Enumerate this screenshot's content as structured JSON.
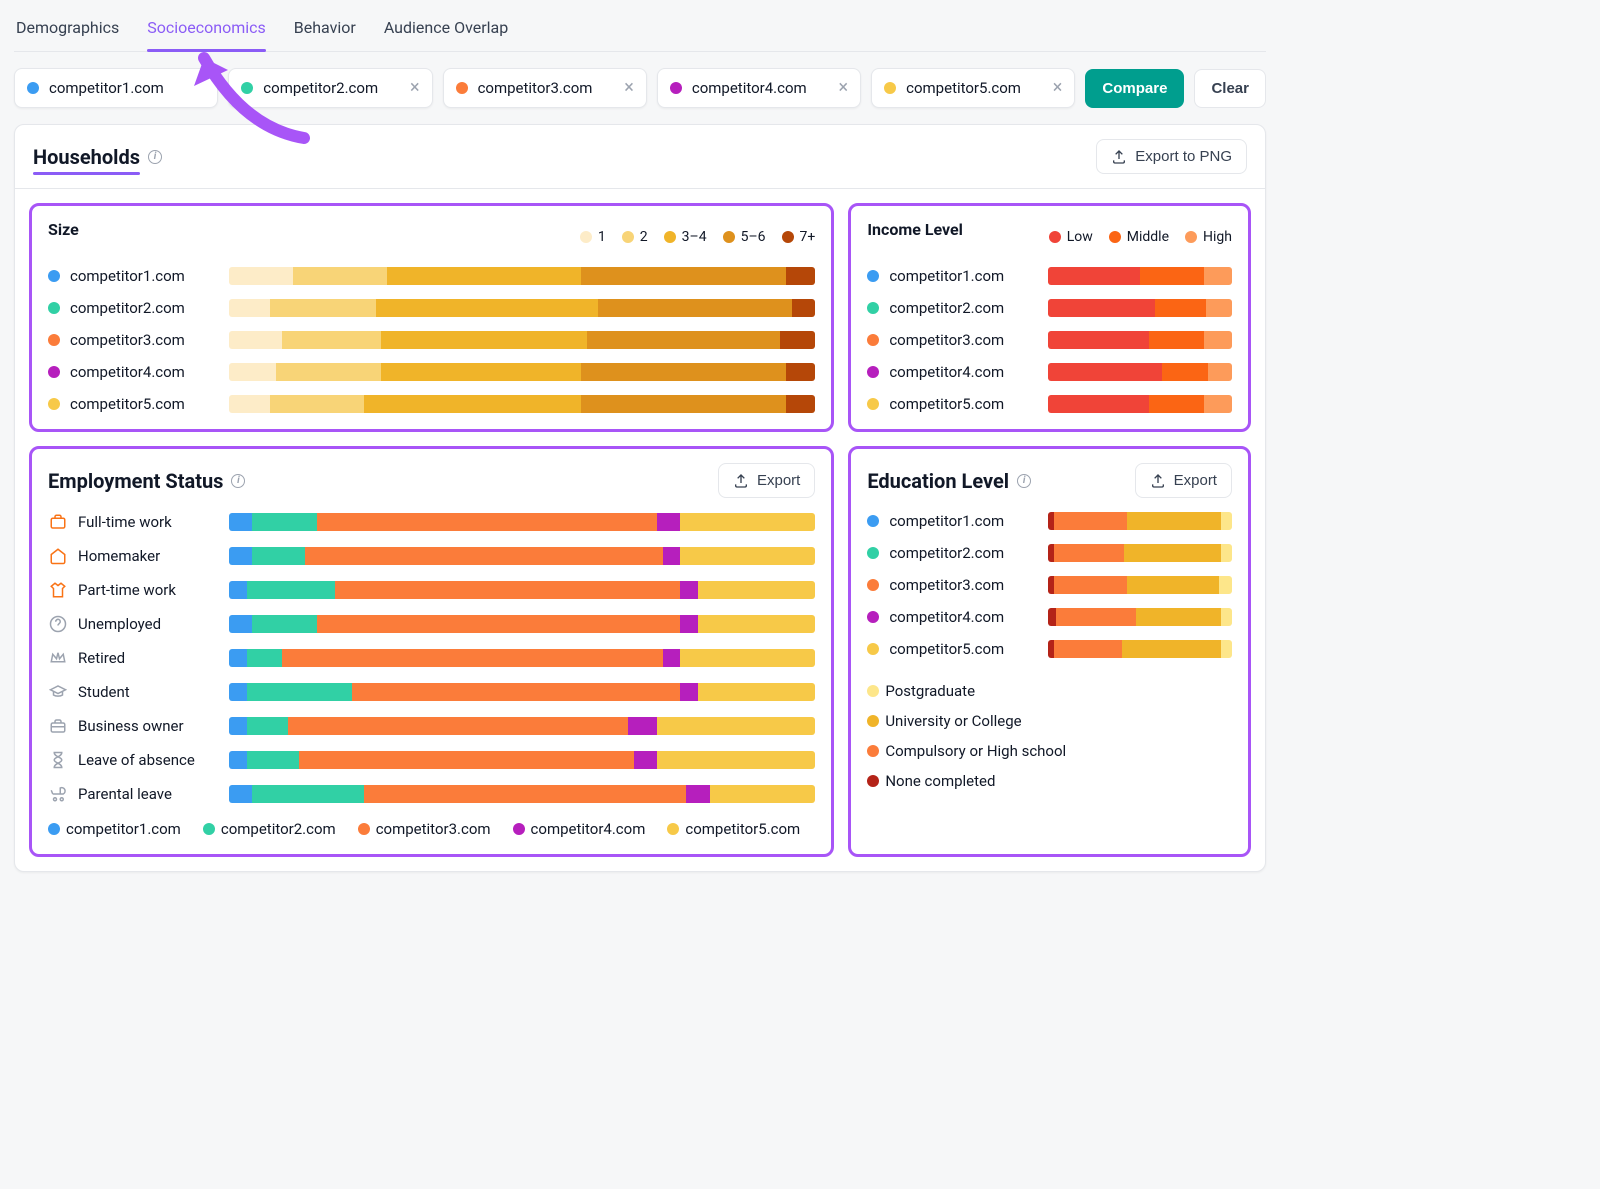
{
  "tabs": [
    "Demographics",
    "Socioeconomics",
    "Behavior",
    "Audience Overlap"
  ],
  "active_tab": 1,
  "competitors": [
    {
      "name": "competitor1.com",
      "color": "#3b9cf2",
      "removable": false
    },
    {
      "name": "competitor2.com",
      "color": "#31d0a5",
      "removable": true
    },
    {
      "name": "competitor3.com",
      "color": "#fb7c3a",
      "removable": true
    },
    {
      "name": "competitor4.com",
      "color": "#b61fbd",
      "removable": true
    },
    {
      "name": "competitor5.com",
      "color": "#f7c948",
      "removable": true
    }
  ],
  "buttons": {
    "compare": "Compare",
    "clear": "Clear",
    "export_png": "Export to PNG",
    "export": "Export"
  },
  "households": {
    "title": "Households"
  },
  "size_panel": {
    "title": "Size",
    "legend": [
      {
        "label": "1",
        "color": "#fdecc8"
      },
      {
        "label": "2",
        "color": "#f8d477"
      },
      {
        "label": "3–4",
        "color": "#f0b429"
      },
      {
        "label": "5–6",
        "color": "#de911d"
      },
      {
        "label": "7+",
        "color": "#b54708"
      }
    ]
  },
  "income_panel": {
    "title": "Income Level",
    "legend": [
      {
        "label": "Low",
        "color": "#f04438"
      },
      {
        "label": "Middle",
        "color": "#fb6514"
      },
      {
        "label": "High",
        "color": "#fd9b5a"
      }
    ]
  },
  "employment": {
    "title": "Employment Status",
    "categories": [
      {
        "label": "Full-time work",
        "icon": "briefcase",
        "dim": false
      },
      {
        "label": "Homemaker",
        "icon": "home",
        "dim": false
      },
      {
        "label": "Part-time work",
        "icon": "shirt",
        "dim": false
      },
      {
        "label": "Unemployed",
        "icon": "question",
        "dim": true
      },
      {
        "label": "Retired",
        "icon": "crown",
        "dim": true
      },
      {
        "label": "Student",
        "icon": "grad",
        "dim": true
      },
      {
        "label": "Business owner",
        "icon": "suitcase",
        "dim": true
      },
      {
        "label": "Leave of absence",
        "icon": "hourglass",
        "dim": true
      },
      {
        "label": "Parental leave",
        "icon": "stroller",
        "dim": true
      }
    ]
  },
  "education": {
    "title": "Education Level",
    "legend": [
      {
        "label": "Postgraduate",
        "color": "#fde68a"
      },
      {
        "label": "University or College",
        "color": "#f0b429"
      },
      {
        "label": "Compulsory or High school",
        "color": "#fb7c3a"
      },
      {
        "label": "None completed",
        "color": "#b42318"
      }
    ]
  },
  "chart_data": [
    {
      "id": "household_size",
      "type": "stacked-bar",
      "title": "Size",
      "segments": [
        "1",
        "2",
        "3–4",
        "5–6",
        "7+"
      ],
      "colors": [
        "#fdecc8",
        "#f8d477",
        "#f0b429",
        "#de911d",
        "#b54708"
      ],
      "categories": [
        "competitor1.com",
        "competitor2.com",
        "competitor3.com",
        "competitor4.com",
        "competitor5.com"
      ],
      "series_pct": [
        [
          11,
          16,
          33,
          35,
          5
        ],
        [
          7,
          18,
          38,
          33,
          4
        ],
        [
          9,
          17,
          35,
          33,
          6
        ],
        [
          8,
          18,
          34,
          35,
          5
        ],
        [
          7,
          16,
          37,
          35,
          5
        ]
      ]
    },
    {
      "id": "income_level",
      "type": "stacked-bar",
      "title": "Income Level",
      "segments": [
        "Low",
        "Middle",
        "High"
      ],
      "colors": [
        "#f04438",
        "#fb6514",
        "#fd9b5a"
      ],
      "categories": [
        "competitor1.com",
        "competitor2.com",
        "competitor3.com",
        "competitor4.com",
        "competitor5.com"
      ],
      "series_pct": [
        [
          50,
          35,
          15
        ],
        [
          58,
          28,
          14
        ],
        [
          55,
          30,
          15
        ],
        [
          62,
          25,
          13
        ],
        [
          55,
          30,
          15
        ]
      ]
    },
    {
      "id": "employment_status",
      "type": "stacked-bar",
      "title": "Employment Status",
      "segments": [
        "competitor1.com",
        "competitor2.com",
        "competitor3.com",
        "competitor4.com",
        "competitor5.com"
      ],
      "colors": [
        "#3b9cf2",
        "#31d0a5",
        "#fb7c3a",
        "#b61fbd",
        "#f7c948"
      ],
      "categories": [
        "Full-time work",
        "Homemaker",
        "Part-time work",
        "Unemployed",
        "Retired",
        "Student",
        "Business owner",
        "Leave of absence",
        "Parental leave"
      ],
      "series_pct": [
        [
          4,
          11,
          58,
          4,
          23
        ],
        [
          4,
          9,
          61,
          3,
          23
        ],
        [
          3,
          15,
          59,
          3,
          20
        ],
        [
          4,
          11,
          62,
          3,
          20
        ],
        [
          3,
          6,
          65,
          3,
          23
        ],
        [
          3,
          18,
          56,
          3,
          20
        ],
        [
          3,
          7,
          58,
          5,
          27
        ],
        [
          3,
          9,
          57,
          4,
          27
        ],
        [
          4,
          19,
          55,
          4,
          18
        ]
      ]
    },
    {
      "id": "education_level",
      "type": "stacked-bar",
      "title": "Education Level",
      "segments": [
        "None completed",
        "Compulsory or High school",
        "University or College",
        "Postgraduate"
      ],
      "colors": [
        "#b42318",
        "#fb7c3a",
        "#f0b429",
        "#fde68a"
      ],
      "categories": [
        "competitor1.com",
        "competitor2.com",
        "competitor3.com",
        "competitor4.com",
        "competitor5.com"
      ],
      "series_pct": [
        [
          3,
          40,
          51,
          6
        ],
        [
          3,
          38,
          53,
          6
        ],
        [
          3,
          40,
          50,
          7
        ],
        [
          4,
          44,
          46,
          6
        ],
        [
          3,
          37,
          54,
          6
        ]
      ]
    }
  ]
}
